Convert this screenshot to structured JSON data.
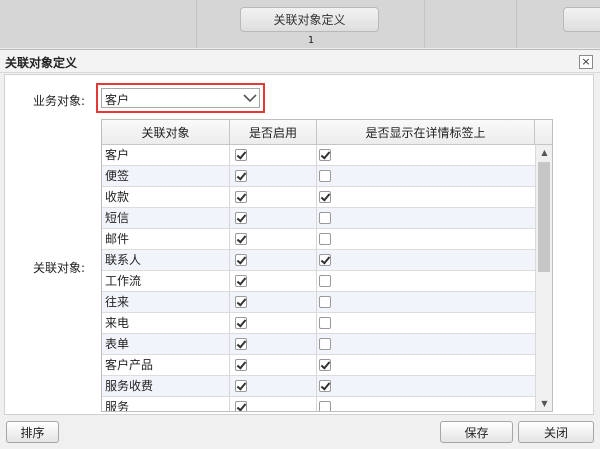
{
  "background": {
    "button_label": "关联对象定义",
    "row_number": "1"
  },
  "dialog": {
    "title": "关联对象定义",
    "close_symbol": "×",
    "business_object_label": "业务对象:",
    "business_object_value": "客户",
    "related_objects_label": "关联对象:",
    "columns": [
      "关联对象",
      "是否启用",
      "是否显示在详情标签上"
    ],
    "rows": [
      {
        "name": "客户",
        "enabled": true,
        "show_in_tab": true
      },
      {
        "name": "便签",
        "enabled": true,
        "show_in_tab": false
      },
      {
        "name": "收款",
        "enabled": true,
        "show_in_tab": true
      },
      {
        "name": "短信",
        "enabled": true,
        "show_in_tab": false
      },
      {
        "name": "邮件",
        "enabled": true,
        "show_in_tab": false
      },
      {
        "name": "联系人",
        "enabled": true,
        "show_in_tab": true
      },
      {
        "name": "工作流",
        "enabled": true,
        "show_in_tab": false
      },
      {
        "name": "往来",
        "enabled": true,
        "show_in_tab": false
      },
      {
        "name": "来电",
        "enabled": true,
        "show_in_tab": false
      },
      {
        "name": "表单",
        "enabled": true,
        "show_in_tab": false
      },
      {
        "name": "客户产品",
        "enabled": true,
        "show_in_tab": true
      },
      {
        "name": "服务收费",
        "enabled": true,
        "show_in_tab": true
      },
      {
        "name": "服务",
        "enabled": true,
        "show_in_tab": false
      }
    ],
    "buttons": {
      "sort": "排序",
      "save": "保存",
      "close": "关闭"
    }
  },
  "colors": {
    "highlight_border": "#e53935",
    "row_alt": "#f1f5fb"
  },
  "icons": {
    "dropdown": "chevron-down-icon",
    "close": "close-icon",
    "scroll_up": "triangle-up-icon",
    "scroll_down": "triangle-down-icon"
  }
}
